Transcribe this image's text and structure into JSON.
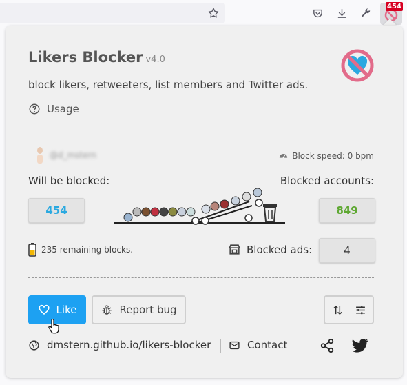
{
  "browser": {
    "badge_count": "454"
  },
  "header": {
    "title": "Likers Blocker",
    "version": "v4.0",
    "description": "block likers, retweeters, list members and Twitter ads.",
    "usage_label": "Usage"
  },
  "stats": {
    "user_handle": "@d_mstern",
    "block_speed": "Block speed: 0 bpm",
    "will_be_blocked_label": "Will be blocked:",
    "will_be_blocked_value": "454",
    "blocked_accounts_label": "Blocked accounts:",
    "blocked_accounts_value": "849",
    "remaining_blocks": "235 remaining blocks.",
    "blocked_ads_label": "Blocked ads:",
    "blocked_ads_value": "4"
  },
  "actions": {
    "like_label": "Like",
    "report_bug_label": "Report bug"
  },
  "footer": {
    "site_link": "dmstern.github.io/likers-blocker",
    "contact_label": "Contact"
  },
  "colors": {
    "accent": "#1da1f2",
    "will_be_blocked": "#2aa9e0",
    "blocked_accounts": "#5ea832",
    "logo_ring": "#e26b8a"
  }
}
